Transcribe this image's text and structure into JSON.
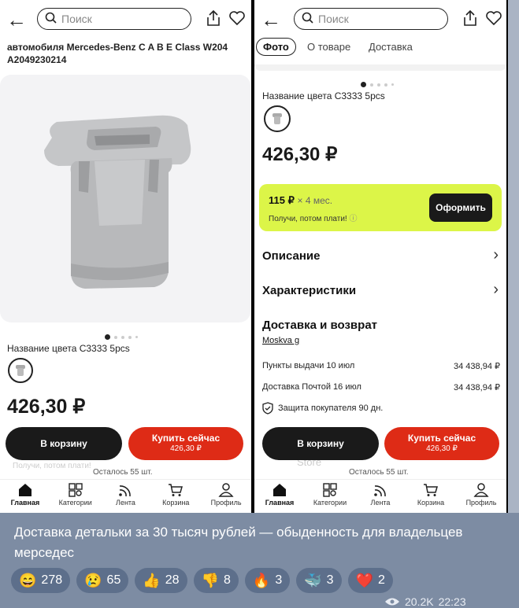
{
  "left_screen": {
    "search_placeholder": "Поиск",
    "breadcrumb": [
      "автомобиля Mercedes-Benz C A B E Class W204",
      "A2049230214"
    ],
    "color_label": "Название цвета C3333 5pcs",
    "price": "426,30 ₽",
    "cart_button": "В корзину",
    "buy_button": "Купить сейчас",
    "buy_price": "426,30 ₽",
    "faint_text": "Получи, потом плати!",
    "remaining": "Осталось 55 шт."
  },
  "right_screen": {
    "search_placeholder": "Поиск",
    "tabs": [
      "Фото",
      "О товаре",
      "Доставка"
    ],
    "color_label": "Название цвета C3333 5pcs",
    "price": "426,30 ₽",
    "bnpl": {
      "amount": "115 ₽",
      "period": "× 4 мес.",
      "note": "Получи, потом плати!",
      "button": "Оформить"
    },
    "sections": [
      "Описание",
      "Характеристики"
    ],
    "delivery": {
      "title": "Доставка и возврат",
      "location": "Moskva g",
      "rows": [
        {
          "label": "Пункты выдачи 10 июл",
          "value": "34 438,94 ₽"
        },
        {
          "label": "Доставка Почтой 16 июл",
          "value": "34 438,94 ₽"
        }
      ],
      "protection": "Защита покупателя 90 дн."
    },
    "cart_button": "В корзину",
    "buy_button": "Купить сейчас",
    "buy_price": "426,30 ₽",
    "faint_text": "Store",
    "remaining": "Осталось 55 шт."
  },
  "nav": [
    {
      "label": "Главная",
      "icon": "home-icon"
    },
    {
      "label": "Категории",
      "icon": "categories-icon"
    },
    {
      "label": "Лента",
      "icon": "feed-icon"
    },
    {
      "label": "Корзина",
      "icon": "cart-icon"
    },
    {
      "label": "Профиль",
      "icon": "profile-icon"
    }
  ],
  "message": {
    "text": "Доставка детальки за 30 тысяч рублей — обыденность для владельцев мерседес",
    "reactions": [
      {
        "emoji": "😄",
        "count": "278"
      },
      {
        "emoji": "😢",
        "count": "65"
      },
      {
        "emoji": "👍",
        "count": "28"
      },
      {
        "emoji": "👎",
        "count": "8"
      },
      {
        "emoji": "🔥",
        "count": "3"
      },
      {
        "emoji": "🐳",
        "count": "3"
      },
      {
        "emoji": "❤️",
        "count": "2"
      }
    ],
    "views": "20.2K",
    "time": "22:23"
  },
  "colors": {
    "accent_red": "#de2b16",
    "bnpl_green": "#dcf548",
    "dark": "#1a1a1a",
    "bg": "#7d8ca3",
    "reaction_bg": "#5d6f8b"
  }
}
